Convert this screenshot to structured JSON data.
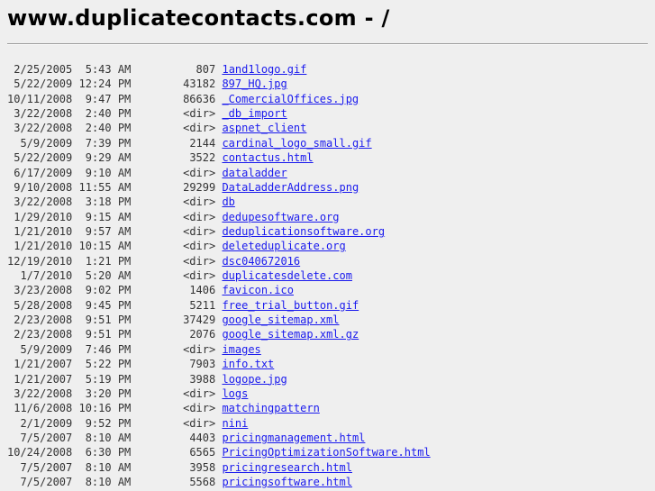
{
  "title": "www.duplicatecontacts.com - /",
  "entries": [
    {
      "date": "2/25/2005",
      "time": "5:43 AM",
      "size": "807",
      "name": "1and1logo.gif"
    },
    {
      "date": "5/22/2009",
      "time": "12:24 PM",
      "size": "43182",
      "name": "897_HQ.jpg"
    },
    {
      "date": "10/11/2008",
      "time": "9:47 PM",
      "size": "86636",
      "name": "_ComercialOffices.jpg"
    },
    {
      "date": "3/22/2008",
      "time": "2:40 PM",
      "size": "<dir>",
      "name": "_db_import"
    },
    {
      "date": "3/22/2008",
      "time": "2:40 PM",
      "size": "<dir>",
      "name": "aspnet_client"
    },
    {
      "date": "5/9/2009",
      "time": "7:39 PM",
      "size": "2144",
      "name": "cardinal_logo_small.gif"
    },
    {
      "date": "5/22/2009",
      "time": "9:29 AM",
      "size": "3522",
      "name": "contactus.html"
    },
    {
      "date": "6/17/2009",
      "time": "9:10 AM",
      "size": "<dir>",
      "name": "dataladder"
    },
    {
      "date": "9/10/2008",
      "time": "11:55 AM",
      "size": "29299",
      "name": "DataLadderAddress.png"
    },
    {
      "date": "3/22/2008",
      "time": "3:18 PM",
      "size": "<dir>",
      "name": "db"
    },
    {
      "date": "1/29/2010",
      "time": "9:15 AM",
      "size": "<dir>",
      "name": "dedupesoftware.org"
    },
    {
      "date": "1/21/2010",
      "time": "9:57 AM",
      "size": "<dir>",
      "name": "deduplicationsoftware.org"
    },
    {
      "date": "1/21/2010",
      "time": "10:15 AM",
      "size": "<dir>",
      "name": "deleteduplicate.org"
    },
    {
      "date": "12/19/2010",
      "time": "1:21 PM",
      "size": "<dir>",
      "name": "dsc040672016"
    },
    {
      "date": "1/7/2010",
      "time": "5:20 AM",
      "size": "<dir>",
      "name": "duplicatesdelete.com"
    },
    {
      "date": "3/23/2008",
      "time": "9:02 PM",
      "size": "1406",
      "name": "favicon.ico"
    },
    {
      "date": "5/28/2008",
      "time": "9:45 PM",
      "size": "5211",
      "name": "free_trial_button.gif"
    },
    {
      "date": "2/23/2008",
      "time": "9:51 PM",
      "size": "37429",
      "name": "google_sitemap.xml"
    },
    {
      "date": "2/23/2008",
      "time": "9:51 PM",
      "size": "2076",
      "name": "google_sitemap.xml.gz"
    },
    {
      "date": "5/9/2009",
      "time": "7:46 PM",
      "size": "<dir>",
      "name": "images"
    },
    {
      "date": "1/21/2007",
      "time": "5:22 PM",
      "size": "7903",
      "name": "info.txt"
    },
    {
      "date": "1/21/2007",
      "time": "5:19 PM",
      "size": "3988",
      "name": "logope.jpg"
    },
    {
      "date": "3/22/2008",
      "time": "3:20 PM",
      "size": "<dir>",
      "name": "logs"
    },
    {
      "date": "11/6/2008",
      "time": "10:16 PM",
      "size": "<dir>",
      "name": "matchingpattern"
    },
    {
      "date": "2/1/2009",
      "time": "9:52 PM",
      "size": "<dir>",
      "name": "nini"
    },
    {
      "date": "7/5/2007",
      "time": "8:10 AM",
      "size": "4403",
      "name": "pricingmanagement.html"
    },
    {
      "date": "10/24/2008",
      "time": "6:30 PM",
      "size": "6565",
      "name": "PricingOptimizationSoftware.html"
    },
    {
      "date": "7/5/2007",
      "time": "8:10 AM",
      "size": "3958",
      "name": "pricingresearch.html"
    },
    {
      "date": "7/5/2007",
      "time": "8:10 AM",
      "size": "5568",
      "name": "pricingsoftware.html"
    }
  ]
}
